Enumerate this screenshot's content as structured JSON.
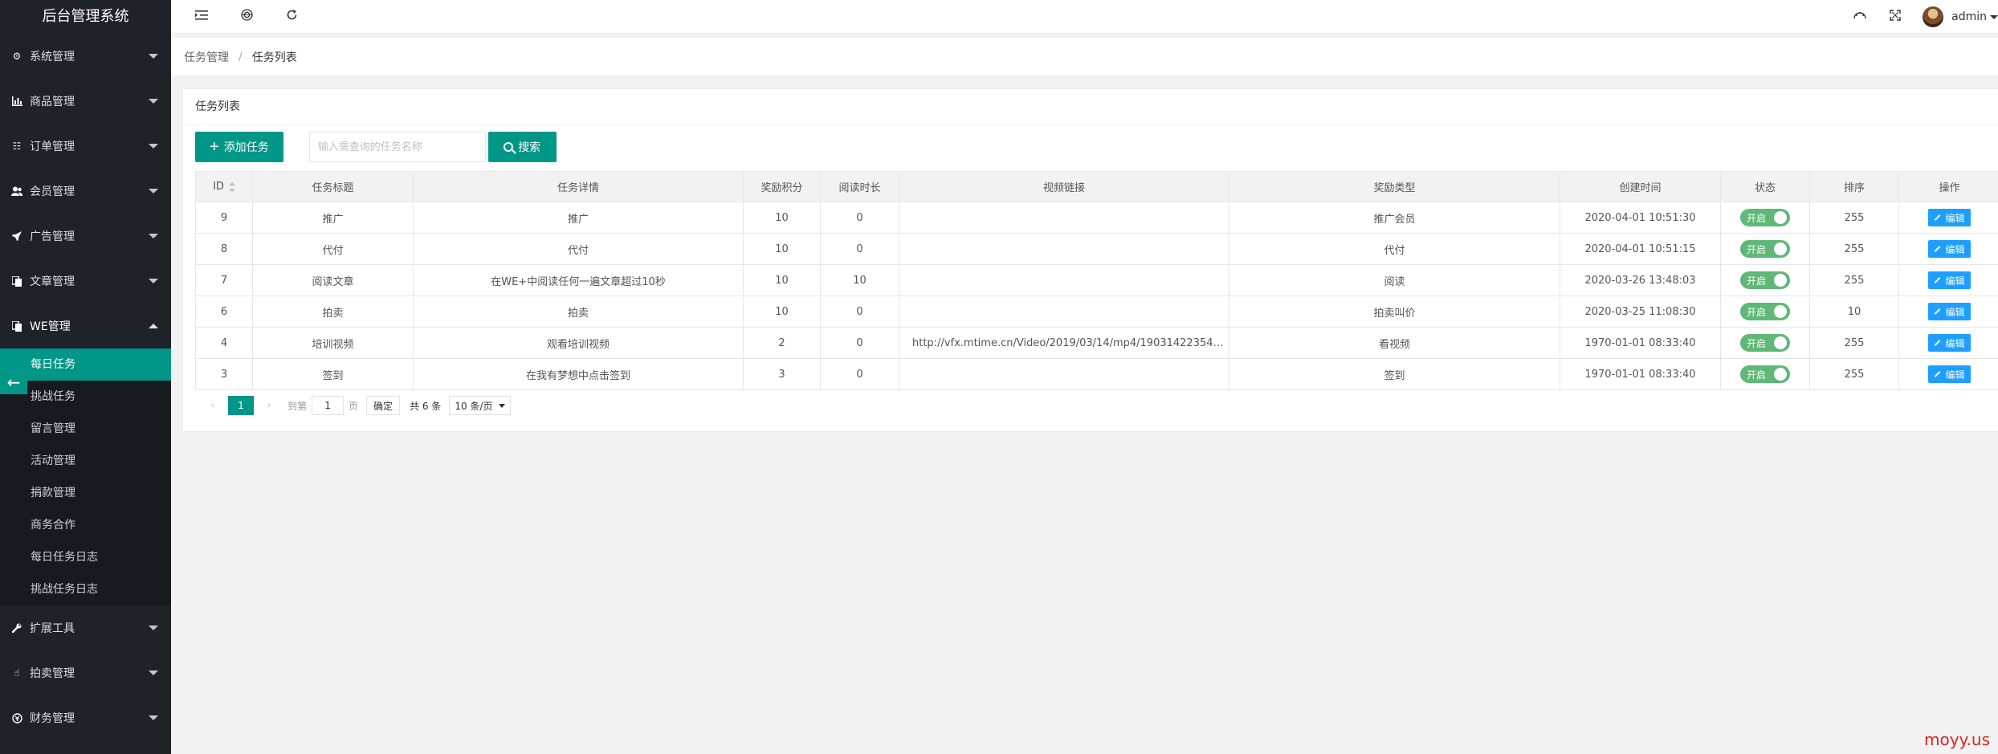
{
  "app": {
    "title": "后台管理系统"
  },
  "sidebar": {
    "menus_top": [
      {
        "label": "系统管理",
        "icon": "gear-icon"
      },
      {
        "label": "商品管理",
        "icon": "chart-icon"
      },
      {
        "label": "订单管理",
        "icon": "list-icon"
      },
      {
        "label": "会员管理",
        "icon": "users-icon"
      },
      {
        "label": "广告管理",
        "icon": "rocket-icon"
      },
      {
        "label": "文章管理",
        "icon": "doc-icon"
      },
      {
        "label": "WE管理",
        "icon": "doc-icon"
      }
    ],
    "sub_items": [
      "每日任务",
      "挑战任务",
      "留言管理",
      "活动管理",
      "捐款管理",
      "商务合作",
      "每日任务日志",
      "挑战任务日志"
    ],
    "menus_bottom": [
      {
        "label": "扩展工具",
        "icon": "wrench-icon"
      },
      {
        "label": "拍卖管理",
        "icon": "hand-icon"
      },
      {
        "label": "财务管理",
        "icon": "money-icon"
      }
    ]
  },
  "header": {
    "username": "admin"
  },
  "breadcrumb": {
    "parent": "任务管理",
    "separator": "/",
    "current": "任务列表"
  },
  "card": {
    "title": "任务列表"
  },
  "toolbar": {
    "add_label": "添加任务",
    "search_placeholder": "输入需查询的任务名称",
    "search_label": "搜索"
  },
  "table": {
    "headers": [
      "ID",
      "任务标题",
      "任务详情",
      "奖励积分",
      "阅读时长",
      "视频链接",
      "奖励类型",
      "创建时间",
      "状态",
      "排序",
      "操作"
    ],
    "rows": [
      {
        "id": "9",
        "title": "推广",
        "detail": "推广",
        "points": "10",
        "read": "0",
        "video": "",
        "reward": "推广会员",
        "created": "2020-04-01 10:51:30",
        "status": "开启",
        "sort": "255",
        "action": "编辑"
      },
      {
        "id": "8",
        "title": "代付",
        "detail": "代付",
        "points": "10",
        "read": "0",
        "video": "",
        "reward": "代付",
        "created": "2020-04-01 10:51:15",
        "status": "开启",
        "sort": "255",
        "action": "编辑"
      },
      {
        "id": "7",
        "title": "阅读文章",
        "detail": "在WE+中阅读任何一遍文章超过10秒",
        "points": "10",
        "read": "10",
        "video": "",
        "reward": "阅读",
        "created": "2020-03-26 13:48:03",
        "status": "开启",
        "sort": "255",
        "action": "编辑"
      },
      {
        "id": "6",
        "title": "拍卖",
        "detail": "拍卖",
        "points": "10",
        "read": "0",
        "video": "",
        "reward": "拍卖叫价",
        "created": "2020-03-25 11:08:30",
        "status": "开启",
        "sort": "10",
        "action": "编辑"
      },
      {
        "id": "4",
        "title": "培训视频",
        "detail": "观看培训视频",
        "points": "2",
        "read": "0",
        "video": "http://vfx.mtime.cn/Video/2019/03/14/mp4/1903142235403...",
        "reward": "看视频",
        "created": "1970-01-01 08:33:40",
        "status": "开启",
        "sort": "255",
        "action": "编辑"
      },
      {
        "id": "3",
        "title": "签到",
        "detail": "在我有梦想中点击签到",
        "points": "3",
        "read": "0",
        "video": "",
        "reward": "签到",
        "created": "1970-01-01 08:33:40",
        "status": "开启",
        "sort": "255",
        "action": "编辑"
      }
    ]
  },
  "pager": {
    "current": "1",
    "goto_label": "到第",
    "page_value": "1",
    "page_unit": "页",
    "confirm": "确定",
    "total": "共 6 条",
    "per_page": "10 条/页"
  },
  "watermark": "moyy.us"
}
